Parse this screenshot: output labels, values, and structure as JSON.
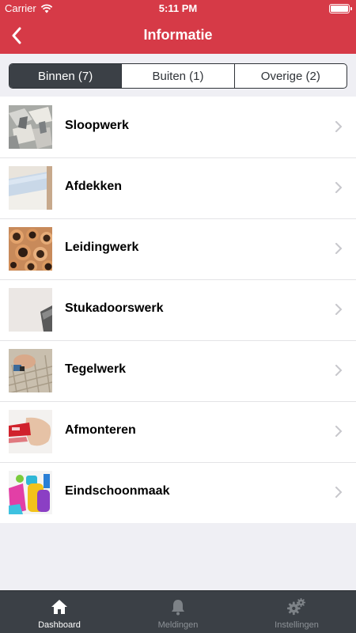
{
  "status_bar": {
    "carrier": "Carrier",
    "time": "5:11 PM"
  },
  "nav": {
    "title": "Informatie",
    "back_icon": "chevron-left-icon"
  },
  "segments": [
    {
      "label": "Binnen (7)",
      "active": true
    },
    {
      "label": "Buiten (1)",
      "active": false
    },
    {
      "label": "Overige (2)",
      "active": false
    }
  ],
  "list": {
    "items": [
      {
        "label": "Sloopwerk",
        "image": "demolition-debris"
      },
      {
        "label": "Afdekken",
        "image": "protective-cover-roll"
      },
      {
        "label": "Leidingwerk",
        "image": "copper-pipes"
      },
      {
        "label": "Stukadoorswerk",
        "image": "plaster-wall"
      },
      {
        "label": "Tegelwerk",
        "image": "tiling-hand"
      },
      {
        "label": "Afmonteren",
        "image": "fitting-hand"
      },
      {
        "label": "Eindschoonmaak",
        "image": "cleaning-supplies"
      }
    ]
  },
  "tab_bar": {
    "tabs": [
      {
        "label": "Dashboard",
        "icon": "home-icon",
        "active": true
      },
      {
        "label": "Meldingen",
        "icon": "bell-icon",
        "active": false
      },
      {
        "label": "Instellingen",
        "icon": "gears-icon",
        "active": false
      }
    ]
  },
  "colors": {
    "brand_red": "#d63a47",
    "dark": "#3b4046",
    "background": "#efeff4"
  }
}
